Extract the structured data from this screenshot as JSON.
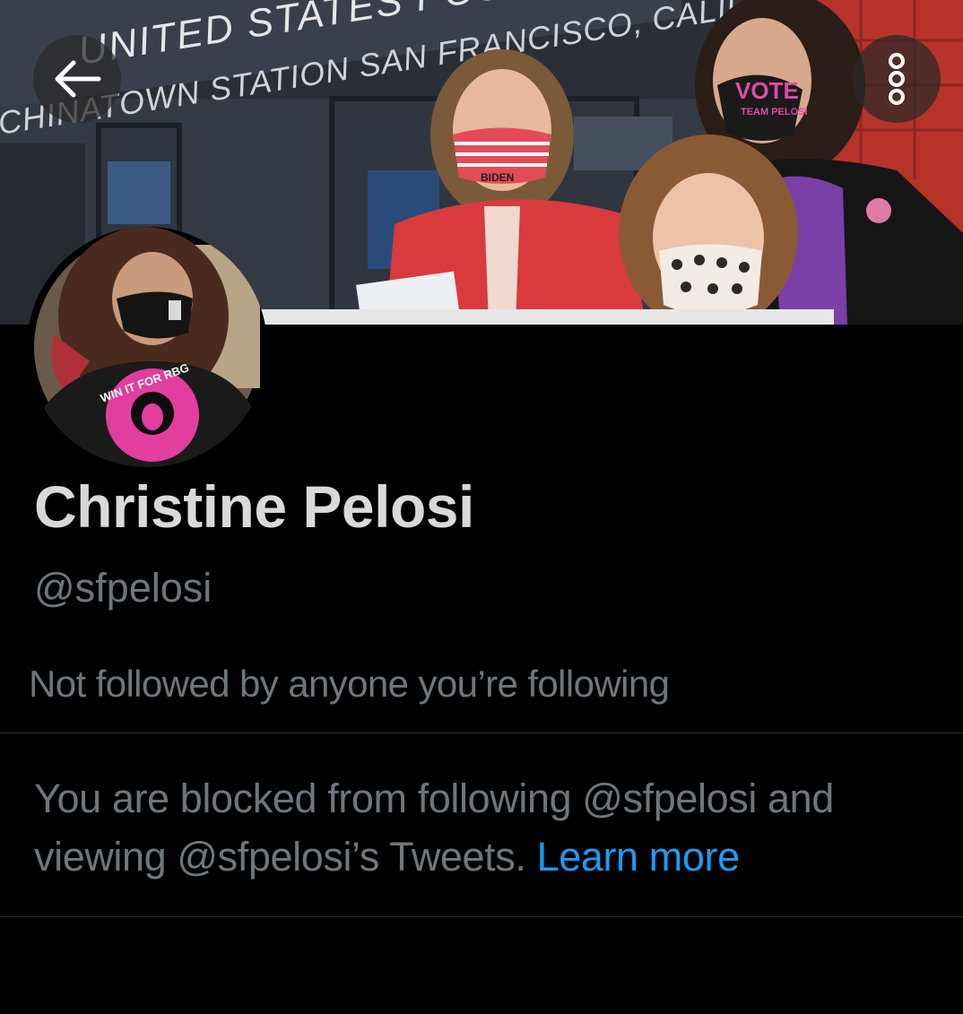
{
  "banner": {
    "storefront_sign_line1": "UNITED STATES POST",
    "storefront_sign_line2": "CHINATOWN STATION SAN FRANCISCO, CALIFORNIA",
    "mask_print": "VOTE",
    "mask_print_sub": "TEAM PELOSI",
    "mask_print_left": "BIDEN"
  },
  "avatar": {
    "shirt_print": "WIN IT FOR RBG"
  },
  "profile": {
    "display_name": "Christine Pelosi",
    "handle": "@sfpelosi",
    "followers_note": "Not followed by anyone you’re following"
  },
  "blocked": {
    "line1": "You are blocked from following @sfpelosi and",
    "line2_prefix": "viewing @sfpelosi’s Tweets.",
    "link_label": "Learn more"
  },
  "colors": {
    "background": "#000000",
    "primary_text": "#d9d9d9",
    "secondary_text": "#6e767d",
    "link": "#1d9bf0",
    "divider": "#2f3336"
  },
  "icons": {
    "back": "arrow-left-icon",
    "more": "more-vertical-icon"
  }
}
